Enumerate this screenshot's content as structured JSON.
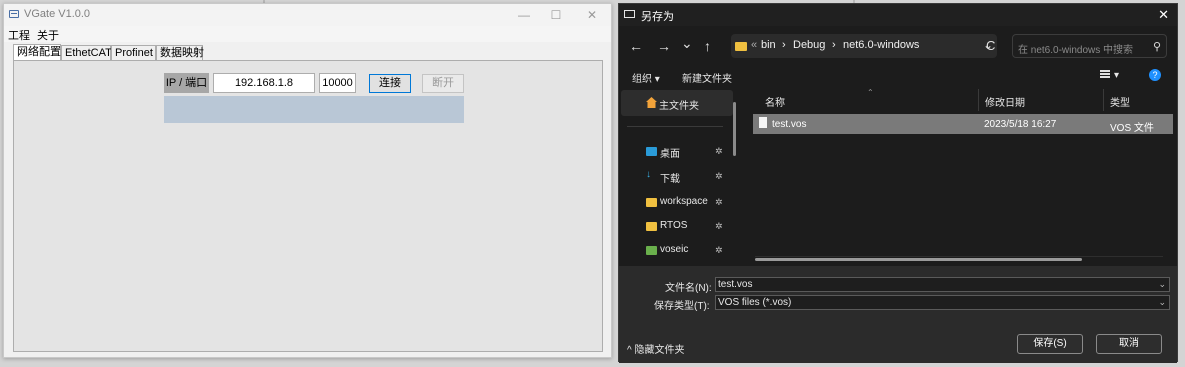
{
  "vgate": {
    "title": "VGate V1.0.0",
    "controls": {
      "minimize": "—",
      "maximize": "☐",
      "close": "✕"
    },
    "menu": [
      "工程",
      "关于"
    ],
    "tabs": [
      "网络配置",
      "EthetCAT",
      "Profinet",
      "数据映射"
    ],
    "active_tab": "网络配置",
    "ip_label": "IP / 端口",
    "ip_value": "192.168.1.8",
    "port_value": "10000",
    "connect_label": "连接",
    "disconnect_label": "断开",
    "status_color": "#b9c7d6"
  },
  "dialog": {
    "title": "另存为",
    "close": "✕",
    "nav": {
      "back": "←",
      "forward": "→",
      "recent": "⌄",
      "up": "↑",
      "refresh": "C"
    },
    "breadcrumb": {
      "sep_leading": "«",
      "parts": [
        "bin",
        "Debug",
        "net6.0-windows"
      ],
      "separator": "›"
    },
    "search_placeholder": "在 net6.0-windows 中搜索",
    "toolbar": {
      "organize": "组织 ▾",
      "new_folder": "新建文件夹",
      "view_chev": "▾",
      "help": "?"
    },
    "sidebar": [
      {
        "label": "主文件夹",
        "icon": "home-icon",
        "selected": true
      },
      {
        "label": "桌面",
        "icon": "desktop-icon",
        "pin": "📌"
      },
      {
        "label": "下载",
        "icon": "download-icon",
        "pin": "📌"
      },
      {
        "label": "workspace",
        "icon": "folder-icon",
        "pin": "📌"
      },
      {
        "label": "RTOS",
        "icon": "folder-icon",
        "pin": "📌"
      },
      {
        "label": "voseic",
        "icon": "folder-special-icon",
        "pin": "📌"
      }
    ],
    "columns": {
      "name": "名称",
      "modified": "修改日期",
      "type": "类型"
    },
    "files": [
      {
        "name": "test.vos",
        "modified": "2023/5/18 16:27",
        "type": "VOS 文件",
        "selected": true
      }
    ],
    "filename_label": "文件名(N):",
    "filename_value": "test.vos",
    "filetype_label": "保存类型(T):",
    "filetype_value": "VOS files (*.vos)",
    "hide_folders": "^ 隐藏文件夹",
    "save_button": "保存(S)",
    "cancel_button": "取消",
    "accent": "#1e90ff"
  }
}
